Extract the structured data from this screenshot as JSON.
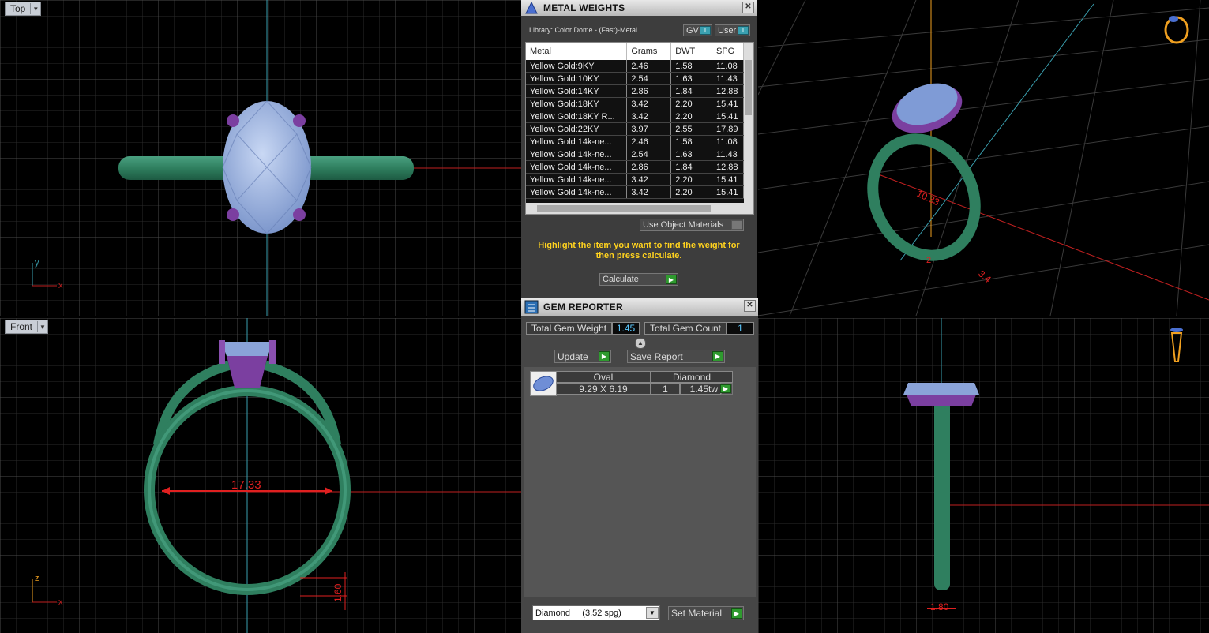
{
  "viewports": {
    "top": {
      "label": "Top",
      "axis_y": "y",
      "axis_x": "x"
    },
    "front": {
      "label": "Front",
      "axis_z": "z",
      "axis_x": "x",
      "dim_width": "17.33",
      "dim_thickness": "1.60"
    },
    "perspective": {
      "dim_a": "10.33",
      "dim_b": "3.4",
      "dim_c": "2"
    },
    "right": {
      "dim_width": "1.80"
    }
  },
  "metal_weights": {
    "title": "METAL WEIGHTS",
    "library": "Library: Color Dome - (Fast)-Metal",
    "toggles": [
      "GV",
      "User"
    ],
    "columns": [
      "Metal",
      "Grams",
      "DWT",
      "SPG"
    ],
    "rows": [
      [
        "Yellow Gold:9KY",
        "2.46",
        "1.58",
        "11.08"
      ],
      [
        "Yellow Gold:10KY",
        "2.54",
        "1.63",
        "11.43"
      ],
      [
        "Yellow Gold:14KY",
        "2.86",
        "1.84",
        "12.88"
      ],
      [
        "Yellow Gold:18KY",
        "3.42",
        "2.20",
        "15.41"
      ],
      [
        "Yellow Gold:18KY R...",
        "3.42",
        "2.20",
        "15.41"
      ],
      [
        "Yellow Gold:22KY",
        "3.97",
        "2.55",
        "17.89"
      ],
      [
        "Yellow Gold 14k-ne...",
        "2.46",
        "1.58",
        "11.08"
      ],
      [
        "Yellow Gold 14k-ne...",
        "2.54",
        "1.63",
        "11.43"
      ],
      [
        "Yellow Gold 14k-ne...",
        "2.86",
        "1.84",
        "12.88"
      ],
      [
        "Yellow Gold 14k-ne...",
        "3.42",
        "2.20",
        "15.41"
      ],
      [
        "Yellow Gold 14k-ne...",
        "3.42",
        "2.20",
        "15.41"
      ]
    ],
    "use_object_materials": "Use Object Materials",
    "hint": "Highlight the item you want to find the weight for then press calculate.",
    "calculate": "Calculate"
  },
  "gem_reporter": {
    "title": "GEM REPORTER",
    "total_weight_label": "Total Gem Weight",
    "total_weight_value": "1.45",
    "total_count_label": "Total Gem Count",
    "total_count_value": "1",
    "update": "Update",
    "save_report": "Save Report",
    "gem": {
      "shape": "Oval",
      "material": "Diamond",
      "size": "9.29 X 6.19",
      "count": "1",
      "weight": "1.45tw"
    },
    "material_select": "Diamond     (3.52 spg)",
    "set_material": "Set Material"
  },
  "colors": {
    "band": "#2f7f5f",
    "prong": "#7b3fa0",
    "gem": "#9ab2e0",
    "grid": "#3a3a3a",
    "dimension": "#e02020"
  }
}
